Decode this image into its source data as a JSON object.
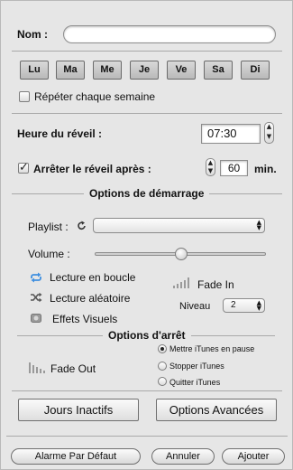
{
  "name_row": {
    "label": "Nom :",
    "value": "",
    "placeholder": ""
  },
  "days": [
    "Lu",
    "Ma",
    "Me",
    "Je",
    "Ve",
    "Sa",
    "Di"
  ],
  "repeat_weekly": {
    "label": "Répéter chaque semaine",
    "checked": false
  },
  "wake_time": {
    "label": "Heure du réveil :",
    "value": "07:30"
  },
  "stop_after": {
    "label": "Arrêter le réveil après :",
    "checked": true,
    "value": "60",
    "unit": "min."
  },
  "start_options": {
    "title": "Options de démarrage",
    "playlist_label": "Playlist :",
    "playlist_value": "",
    "volume_label": "Volume :",
    "volume_level": 0.48,
    "loop_label": "Lecture en boucle",
    "shuffle_label": "Lecture aléatoire",
    "visuals_label": "Effets Visuels",
    "fade_in_label": "Fade In",
    "level_label": "Niveau",
    "level_value": "2"
  },
  "stop_options": {
    "title": "Options d'arrêt",
    "fade_out_label": "Fade Out",
    "radios": [
      {
        "label": "Mettre iTunes en pause",
        "selected": true
      },
      {
        "label": "Stopper iTunes",
        "selected": false
      },
      {
        "label": "Quitter iTunes",
        "selected": false
      }
    ]
  },
  "buttons": {
    "inactive_days": "Jours Inactifs",
    "advanced": "Options Avancées",
    "default_alarm": "Alarme Par Défaut",
    "cancel": "Annuler",
    "add": "Ajouter"
  },
  "colors": {
    "accent_blue": "#3f8fe0",
    "panel_bg": "#e6e6e6"
  }
}
